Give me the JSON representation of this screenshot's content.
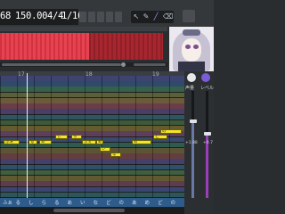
{
  "transport": {
    "measure": "68",
    "tempo": "150.00",
    "time_signature": "4/4",
    "quantize": "1/16"
  },
  "piano_roll": {
    "ruler_marks": [
      "17",
      "18",
      "19"
    ],
    "notes": [
      {
        "lyric": "ふぁ"
      },
      {
        "lyric": "る"
      },
      {
        "lyric": "あ"
      },
      {
        "lyric": "し"
      },
      {
        "lyric": "ら"
      },
      {
        "lyric": "ふぇ"
      },
      {
        "lyric": "あ"
      },
      {
        "lyric": "い"
      },
      {
        "lyric": "な"
      },
      {
        "lyric": "あ"
      },
      {
        "lyric": "ど"
      },
      {
        "lyric": "の"
      }
    ],
    "lyric_strip": [
      "ふぁ",
      "る",
      "し",
      "ら",
      "る",
      "あ",
      "い",
      "な",
      "ど",
      "の",
      "あ",
      "め",
      "ど",
      "の"
    ]
  },
  "mixer": {
    "strip1_label": "声量",
    "strip2_label": "レベル",
    "strip1_db": "+1.88",
    "strip2_db": "+0.7"
  },
  "colors": {
    "arrangement_clip": "#e64352",
    "note": "#f2e52d",
    "accent": "#7a5cd6"
  }
}
